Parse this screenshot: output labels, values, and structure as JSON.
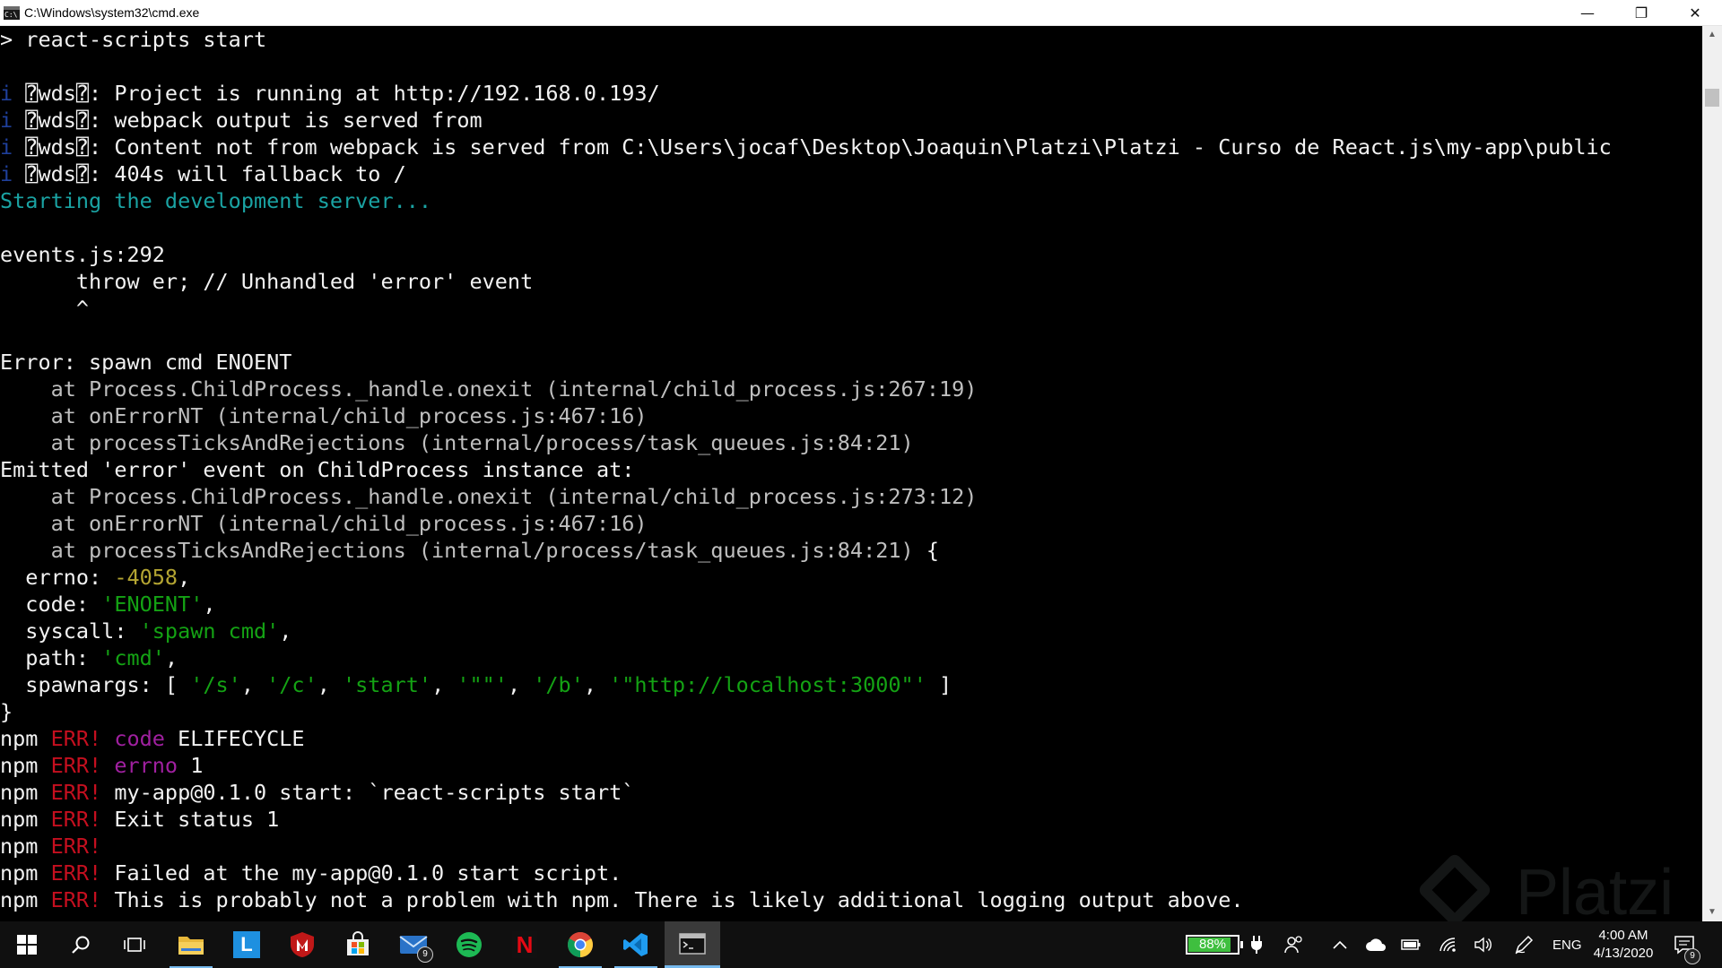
{
  "window": {
    "title": "C:\\Windows\\system32\\cmd.exe",
    "minimize_glyph": "—",
    "restore_glyph": "❐",
    "close_glyph": "✕"
  },
  "console": {
    "lines": [
      [
        {
          "t": "> react-scripts start",
          "c": "w"
        }
      ],
      [],
      [
        {
          "t": "i ",
          "c": "info"
        },
        {
          "t": "⍰wds⍰: Project is running at http://192.168.0.193/",
          "c": "w"
        }
      ],
      [
        {
          "t": "i ",
          "c": "info"
        },
        {
          "t": "⍰wds⍰: webpack output is served from",
          "c": "w"
        }
      ],
      [
        {
          "t": "i ",
          "c": "info"
        },
        {
          "t": "⍰wds⍰: Content not from webpack is served from C:\\Users\\jocaf\\Desktop\\Joaquin\\Platzi\\Platzi - Curso de React.js\\my-app\\public",
          "c": "w"
        }
      ],
      [
        {
          "t": "i ",
          "c": "info"
        },
        {
          "t": "⍰wds⍰: 404s will fallback to /",
          "c": "w"
        }
      ],
      [
        {
          "t": "Starting the development server...",
          "c": "cy"
        }
      ],
      [],
      [
        {
          "t": "events.js:292",
          "c": "w"
        }
      ],
      [
        {
          "t": "      throw er; // Unhandled 'error' event",
          "c": "w"
        }
      ],
      [
        {
          "t": "      ^",
          "c": "w"
        }
      ],
      [],
      [
        {
          "t": "Error: spawn cmd ENOENT",
          "c": "w"
        }
      ],
      [
        {
          "t": "    at Process.ChildProcess._handle.onexit (internal/child_process.js:267:19)",
          "c": "g"
        }
      ],
      [
        {
          "t": "    at onErrorNT (internal/child_process.js:467:16)",
          "c": "g"
        }
      ],
      [
        {
          "t": "    at processTicksAndRejections (internal/process/task_queues.js:84:21)",
          "c": "g"
        }
      ],
      [
        {
          "t": "Emitted 'error' event on ChildProcess instance at:",
          "c": "w"
        }
      ],
      [
        {
          "t": "    at Process.ChildProcess._handle.onexit (internal/child_process.js:273:12)",
          "c": "g"
        }
      ],
      [
        {
          "t": "    at onErrorNT (internal/child_process.js:467:16)",
          "c": "g"
        }
      ],
      [
        {
          "t": "    at processTicksAndRejections (internal/process/task_queues.js:84:21)",
          "c": "g"
        },
        {
          "t": " {",
          "c": "w"
        }
      ],
      [
        {
          "t": "  errno: ",
          "c": "w"
        },
        {
          "t": "-4058",
          "c": "yel"
        },
        {
          "t": ",",
          "c": "w"
        }
      ],
      [
        {
          "t": "  code: ",
          "c": "w"
        },
        {
          "t": "'ENOENT'",
          "c": "grn"
        },
        {
          "t": ",",
          "c": "w"
        }
      ],
      [
        {
          "t": "  syscall: ",
          "c": "w"
        },
        {
          "t": "'spawn cmd'",
          "c": "grn"
        },
        {
          "t": ",",
          "c": "w"
        }
      ],
      [
        {
          "t": "  path: ",
          "c": "w"
        },
        {
          "t": "'cmd'",
          "c": "grn"
        },
        {
          "t": ",",
          "c": "w"
        }
      ],
      [
        {
          "t": "  spawnargs: [ ",
          "c": "w"
        },
        {
          "t": "'/s'",
          "c": "grn"
        },
        {
          "t": ", ",
          "c": "w"
        },
        {
          "t": "'/c'",
          "c": "grn"
        },
        {
          "t": ", ",
          "c": "w"
        },
        {
          "t": "'start'",
          "c": "grn"
        },
        {
          "t": ", ",
          "c": "w"
        },
        {
          "t": "'\"\"'",
          "c": "grn"
        },
        {
          "t": ", ",
          "c": "w"
        },
        {
          "t": "'/b'",
          "c": "grn"
        },
        {
          "t": ", ",
          "c": "w"
        },
        {
          "t": "'\"http://localhost:3000\"'",
          "c": "grn"
        },
        {
          "t": " ]",
          "c": "w"
        }
      ],
      [
        {
          "t": "}",
          "c": "w"
        }
      ],
      [
        {
          "t": "npm ",
          "c": "w"
        },
        {
          "t": "ERR!",
          "c": "red"
        },
        {
          "t": " ",
          "c": "w"
        },
        {
          "t": "code",
          "c": "mag"
        },
        {
          "t": " ELIFECYCLE",
          "c": "w"
        }
      ],
      [
        {
          "t": "npm ",
          "c": "w"
        },
        {
          "t": "ERR!",
          "c": "red"
        },
        {
          "t": " ",
          "c": "w"
        },
        {
          "t": "errno",
          "c": "mag"
        },
        {
          "t": " 1",
          "c": "w"
        }
      ],
      [
        {
          "t": "npm ",
          "c": "w"
        },
        {
          "t": "ERR!",
          "c": "red"
        },
        {
          "t": " my-app@0.1.0 start: `react-scripts start`",
          "c": "w"
        }
      ],
      [
        {
          "t": "npm ",
          "c": "w"
        },
        {
          "t": "ERR!",
          "c": "red"
        },
        {
          "t": " Exit status 1",
          "c": "w"
        }
      ],
      [
        {
          "t": "npm ",
          "c": "w"
        },
        {
          "t": "ERR!",
          "c": "red"
        }
      ],
      [
        {
          "t": "npm ",
          "c": "w"
        },
        {
          "t": "ERR!",
          "c": "red"
        },
        {
          "t": " Failed at the my-app@0.1.0 start script.",
          "c": "w"
        }
      ],
      [
        {
          "t": "npm ",
          "c": "w"
        },
        {
          "t": "ERR!",
          "c": "red"
        },
        {
          "t": " This is probably not a problem with npm. There is likely additional logging output above.",
          "c": "w"
        }
      ]
    ]
  },
  "watermark": {
    "text": "Platzi"
  },
  "taskbar": {
    "apps": [
      {
        "name": "start-button",
        "icon": "windows-logo-icon"
      },
      {
        "name": "search-button",
        "icon": "search-icon"
      },
      {
        "name": "task-view-button",
        "icon": "task-view-icon"
      },
      {
        "name": "taskbar-file-explorer",
        "icon": "folder-icon"
      },
      {
        "name": "taskbar-app-l",
        "icon": "l-app-icon",
        "label": "L"
      },
      {
        "name": "taskbar-mcafee",
        "icon": "shield-icon"
      },
      {
        "name": "taskbar-store",
        "icon": "store-icon"
      },
      {
        "name": "taskbar-mail",
        "icon": "mail-icon",
        "badge": "9"
      },
      {
        "name": "taskbar-spotify",
        "icon": "spotify-icon"
      },
      {
        "name": "taskbar-netflix",
        "icon": "netflix-icon",
        "label": "N"
      },
      {
        "name": "taskbar-chrome",
        "icon": "chrome-icon"
      },
      {
        "name": "taskbar-vscode",
        "icon": "vscode-icon"
      },
      {
        "name": "taskbar-cmd",
        "icon": "terminal-icon"
      }
    ],
    "tray": {
      "battery_percent_text": "88%",
      "battery_level": 0.88,
      "language": "ENG",
      "time": "4:00 AM",
      "date": "4/13/2020",
      "notifications_count": "9"
    },
    "colors": {
      "accent": "#76b9ed",
      "battery_green": "#3fbf3f"
    }
  }
}
